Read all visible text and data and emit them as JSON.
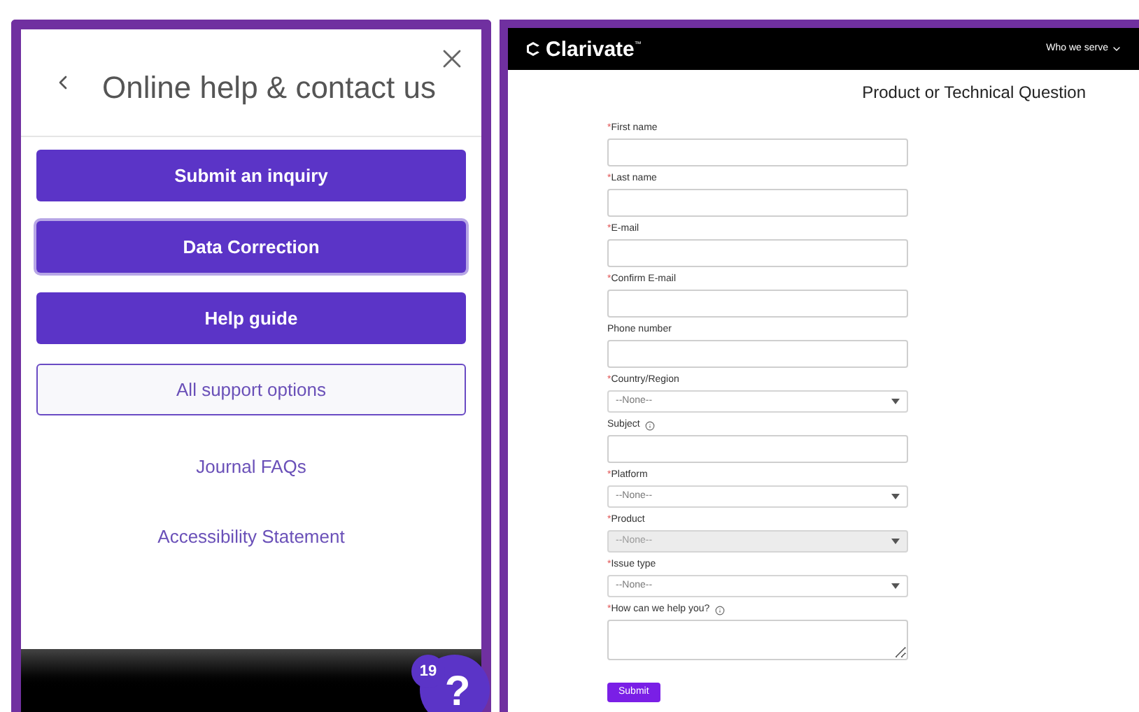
{
  "help_panel": {
    "title": "Online help & contact us",
    "buttons": [
      {
        "label": "Submit an inquiry",
        "kind": "primary",
        "focused": false
      },
      {
        "label": "Data Correction",
        "kind": "primary",
        "focused": true
      },
      {
        "label": "Help guide",
        "kind": "primary",
        "focused": false
      },
      {
        "label": "All support options",
        "kind": "outline",
        "focused": false
      }
    ],
    "links": [
      "Journal FAQs",
      "Accessibility Statement"
    ],
    "help_badge": {
      "count": "19",
      "symbol": "?"
    }
  },
  "site": {
    "logo": "Clarivate",
    "trademark": "™",
    "nav": "Who we serve",
    "title": "Product or Technical Question",
    "fields": [
      {
        "label": "First name",
        "kind": "text",
        "required_mark": "*",
        "info": false,
        "disabled": false
      },
      {
        "label": "Last name",
        "kind": "text",
        "required_mark": "*",
        "info": false,
        "disabled": false
      },
      {
        "label": "E-mail",
        "kind": "text",
        "required_mark": "*",
        "info": false,
        "disabled": false
      },
      {
        "label": "Confirm E-mail",
        "kind": "text",
        "required_mark": "*",
        "info": false,
        "disabled": false
      },
      {
        "label": "Phone number",
        "kind": "text",
        "info": false,
        "disabled": false
      },
      {
        "label": "Country/Region",
        "kind": "select",
        "value": "--None--",
        "required_mark": "*",
        "info": false,
        "disabled": false
      },
      {
        "label": "Subject",
        "kind": "text",
        "info": true,
        "disabled": false
      },
      {
        "label": "Platform",
        "kind": "select",
        "value": "--None--",
        "required_mark": "*",
        "info": false,
        "disabled": false
      },
      {
        "label": "Product",
        "kind": "select",
        "value": "--None--",
        "required_mark": "*",
        "info": false,
        "disabled": true
      },
      {
        "label": "Issue type",
        "kind": "select",
        "value": "--None--",
        "required_mark": "*",
        "info": false,
        "disabled": false
      },
      {
        "label": "How can we help you?",
        "kind": "textarea",
        "required_mark": "*",
        "info": true,
        "disabled": false
      }
    ],
    "submit": "Submit"
  }
}
